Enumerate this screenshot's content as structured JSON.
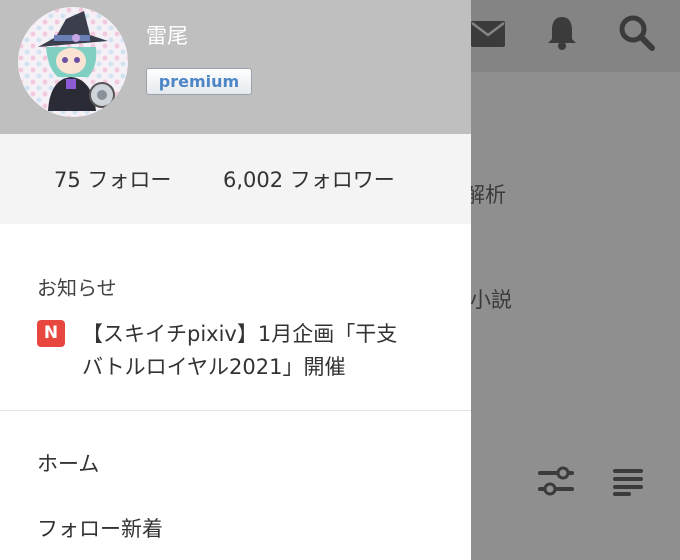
{
  "user": {
    "name": "雷尾",
    "badge": "premium"
  },
  "follow": {
    "following": "75 フォロー",
    "followers": "6,002 フォロワー"
  },
  "notices": {
    "title": "お知らせ",
    "badge": "N",
    "item_line1": "【スキイチpixiv】1月企画「干支",
    "item_line2": "バトルロイヤル2021」開催"
  },
  "menu": {
    "home": "ホーム",
    "follow_new": "フォロー新着"
  },
  "background": {
    "text_analysis": "解析",
    "text_novel": "小説",
    "icons": [
      "mail-icon",
      "bell-icon",
      "search-icon",
      "filter-icon",
      "list-icon"
    ]
  },
  "colors": {
    "accent_premium": "#4f86c6",
    "badge_red": "#e8473f",
    "header_gray": "#bfbfbf",
    "overlay_gray": "#8f8f8f"
  }
}
